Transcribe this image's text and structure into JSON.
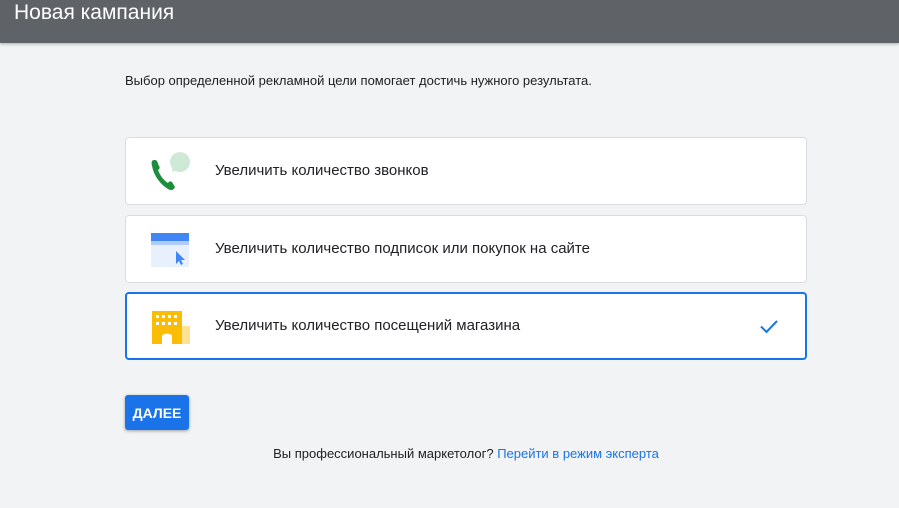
{
  "header": {
    "title": "Новая кампания"
  },
  "subtitle": "Выбор определенной рекламной цели помогает достичь нужного результата.",
  "options": [
    {
      "label": "Увеличить количество звонков",
      "icon": "phone-call-icon",
      "selected": false
    },
    {
      "label": "Увеличить количество подписок или покупок на сайте",
      "icon": "website-click-icon",
      "selected": false
    },
    {
      "label": "Увеличить количество посещений магазина",
      "icon": "store-building-icon",
      "selected": true
    }
  ],
  "next_button": "ДАЛЕЕ",
  "footer": {
    "question": "Вы профессиональный маркетолог?",
    "link": "Перейти в режим эксперта"
  },
  "colors": {
    "accent": "#1a73e8",
    "topbar": "#5f6368",
    "background": "#f1f3f4"
  }
}
